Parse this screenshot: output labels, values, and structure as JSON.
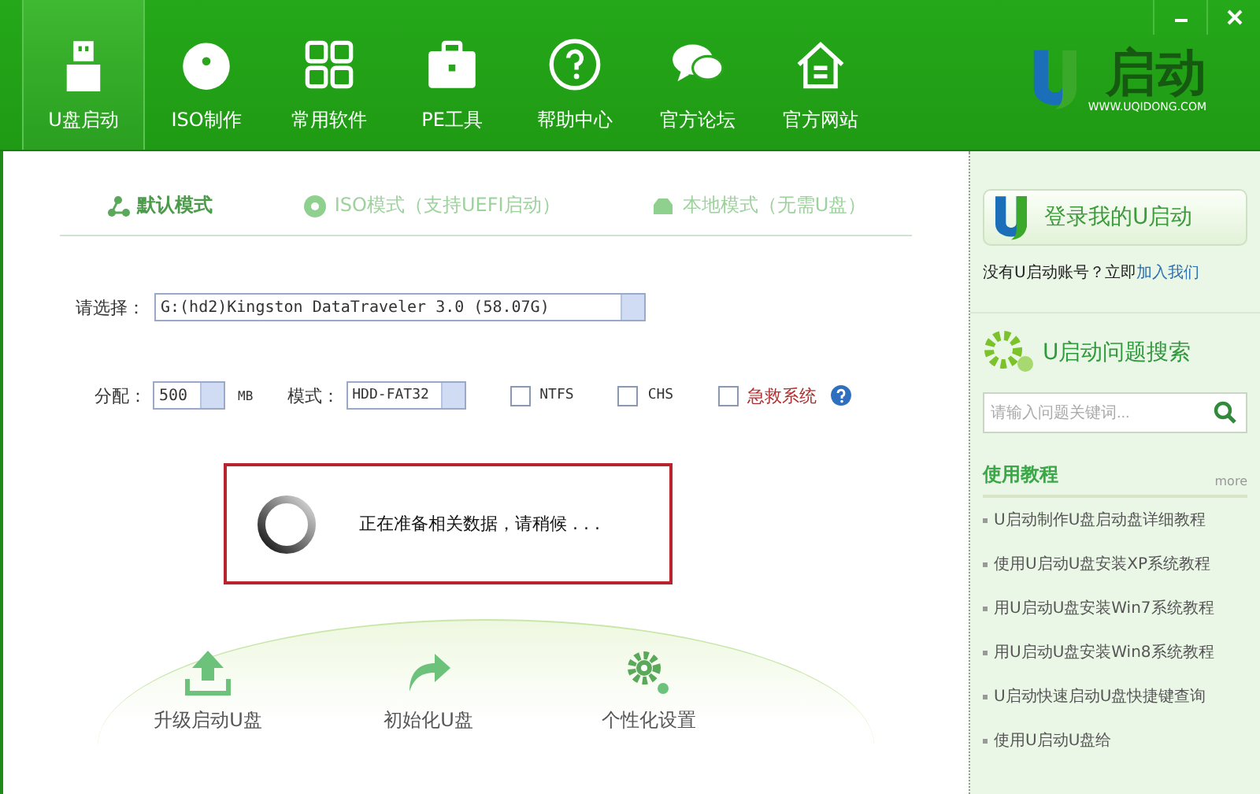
{
  "toolbar": {
    "items": [
      {
        "label": "U盘启动",
        "kind": "usb",
        "selected": true
      },
      {
        "label": "ISO制作",
        "kind": "disc",
        "selected": false
      },
      {
        "label": "常用软件",
        "kind": "grid",
        "selected": false
      },
      {
        "label": "PE工具",
        "kind": "case",
        "selected": false
      },
      {
        "label": "帮助中心",
        "kind": "help",
        "selected": false
      },
      {
        "label": "官方论坛",
        "kind": "chat",
        "selected": false
      },
      {
        "label": "官方网站",
        "kind": "home",
        "selected": false
      }
    ],
    "logo": {
      "text": "启动",
      "url": "WWW.UQIDONG.COM"
    }
  },
  "mode_tabs": [
    {
      "label": "默认模式",
      "kind": "share",
      "selected": true
    },
    {
      "label": "ISO模式（支持UEFI启动）",
      "kind": "disc",
      "selected": false
    },
    {
      "label": "本地模式（无需U盘）",
      "kind": "drive",
      "selected": false
    }
  ],
  "drive": {
    "label": "请选择：",
    "value": "G:(hd2)Kingston DataTraveler 3.0 (58.07G)"
  },
  "options": {
    "alloc_label": "分配：",
    "alloc_value": "500",
    "alloc_unit": "MB",
    "mode_label": "模式：",
    "mode_value": "HDD-FAT32",
    "checkboxes": [
      {
        "label": "NTFS",
        "checked": false,
        "kind": "plain"
      },
      {
        "label": "CHS",
        "checked": false,
        "kind": "plain"
      },
      {
        "label": "急救系统",
        "checked": false,
        "kind": "warn"
      }
    ]
  },
  "loading": {
    "text": "正在准备相关数据，请稍候 . . ."
  },
  "actions": [
    {
      "label": "升级启动U盘",
      "kind": "upload"
    },
    {
      "label": "初始化U盘",
      "kind": "redo"
    },
    {
      "label": "个性化设置",
      "kind": "gear"
    }
  ],
  "sidebar": {
    "login_button": "登录我的U启动",
    "signup_text": "没有U启动账号？立即",
    "signup_link": "加入我们",
    "search_title": "U启动问题搜索",
    "search": {
      "placeholder": "请输入问题关键词..."
    },
    "tutorials": {
      "title": "使用教程",
      "more": "more",
      "items": [
        "U启动制作U盘启动盘详细教程",
        "使用U启动U盘安装XP系统教程",
        "用U启动U盘安装Win7系统教程",
        "用U启动U盘安装Win8系统教程",
        "U启动快速启动U盘快捷键查询",
        "使用U启动U盘给"
      ]
    }
  }
}
